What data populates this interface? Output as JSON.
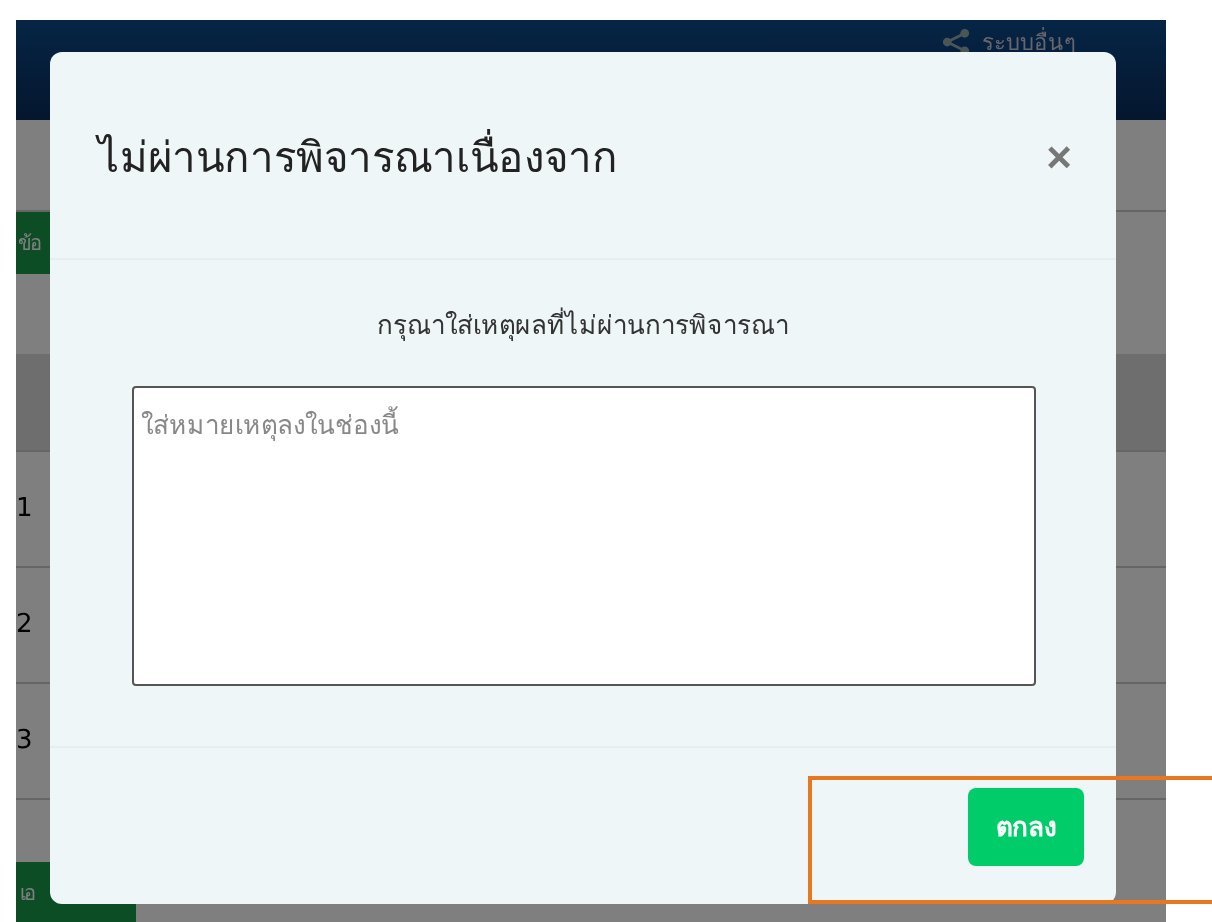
{
  "background_page": {
    "header_link": "ระบบอื่นๆ",
    "side_button_top": "ข้อ",
    "row_numbers": [
      "1",
      "2",
      "3"
    ],
    "side_button_bottom": "เอ"
  },
  "dialog": {
    "title": "ไม่ผ่านการพิจารณาเนื่องจาก",
    "close": "×",
    "prompt": "กรุณาใส่เหตุผลที่ไม่ผ่านการพิจารณา",
    "reason_field": {
      "placeholder": "ใส่หมายเหตุลงในช่องนี้"
    },
    "confirm_button": "ตกลง"
  }
}
